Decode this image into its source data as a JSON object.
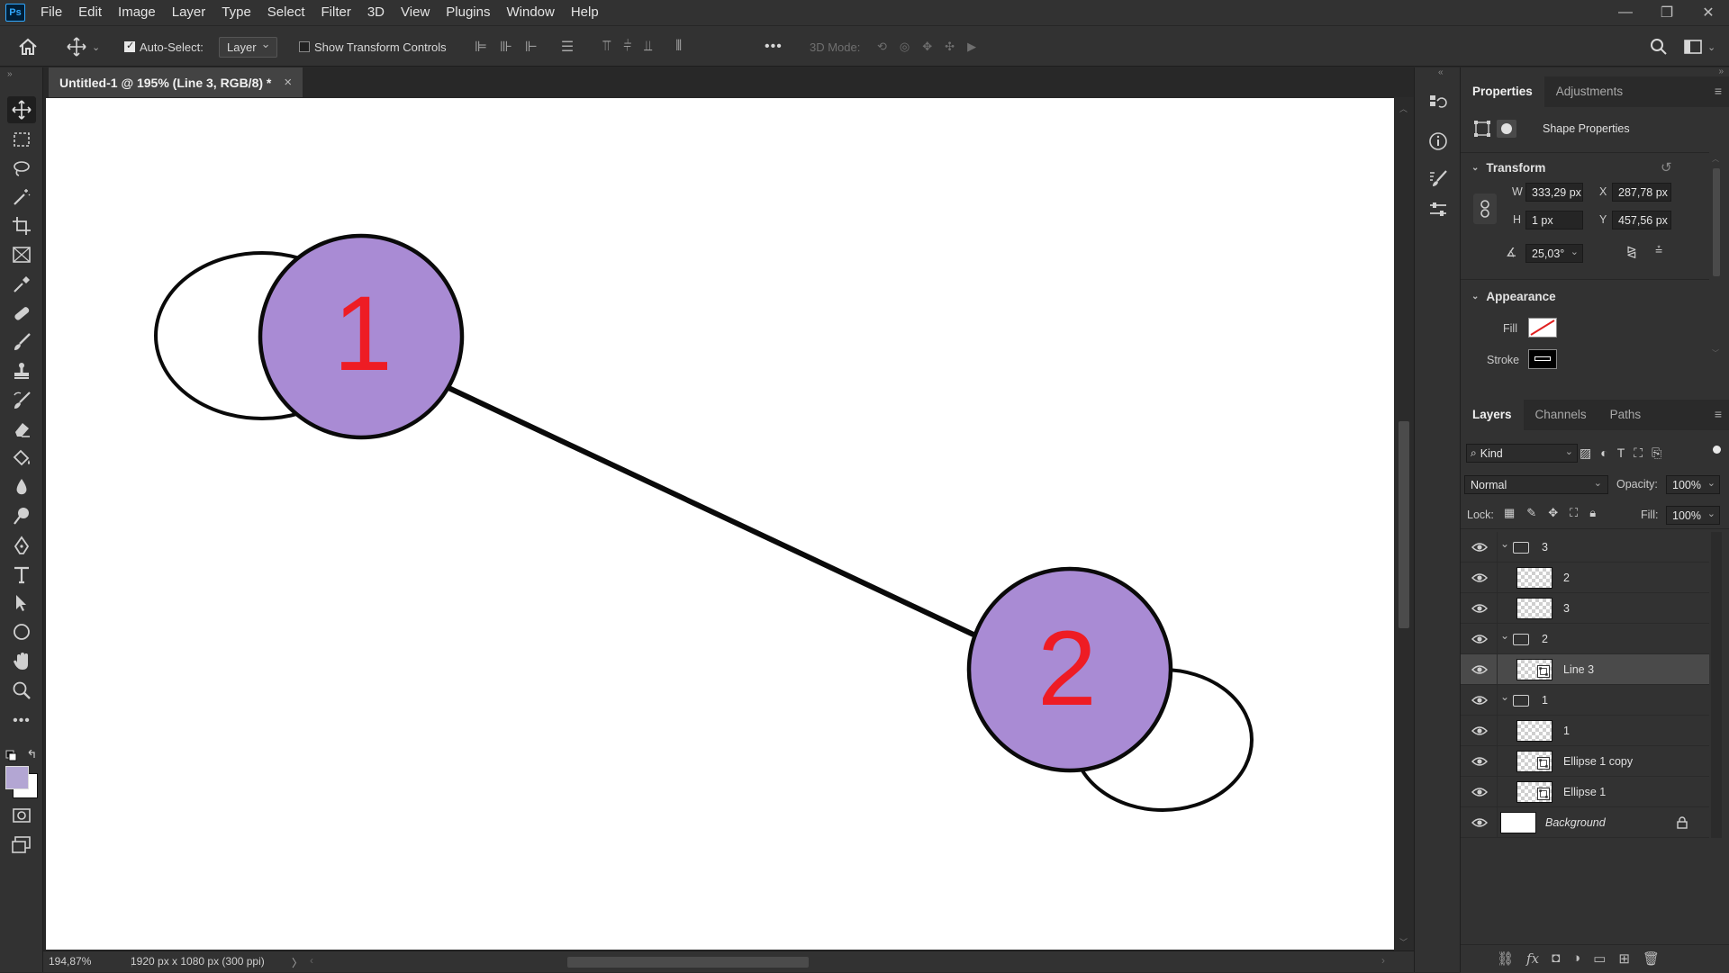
{
  "app": {
    "logo": "Ps"
  },
  "menu": [
    "File",
    "Edit",
    "Image",
    "Layer",
    "Type",
    "Select",
    "Filter",
    "3D",
    "View",
    "Plugins",
    "Window",
    "Help"
  ],
  "window_controls": {
    "minimize": "—",
    "restore": "❐",
    "close": "✕"
  },
  "options_bar": {
    "auto_select_label": "Auto-Select:",
    "auto_select_checked": true,
    "auto_select_target": "Layer",
    "show_transform_label": "Show Transform Controls",
    "show_transform_checked": false,
    "more": "•••",
    "mode_3d_label": "3D Mode:"
  },
  "document": {
    "tab_title": "Untitled-1 @ 195% (Line 3, RGB/8) *",
    "close": "×"
  },
  "canvas": {
    "node1_label": "1",
    "node2_label": "2",
    "node_fill": "#a98bd4",
    "label_color": "#ee1c24"
  },
  "status": {
    "zoom": "194,87%",
    "doc_info": "1920 px x 1080 px (300 ppi)",
    "arrow": "〉"
  },
  "properties_panel": {
    "tabs": [
      "Properties",
      "Adjustments"
    ],
    "active_tab": "Properties",
    "subtitle": "Shape Properties",
    "transform_title": "Transform",
    "w_label": "W",
    "w_value": "333,29 px",
    "x_label": "X",
    "x_value": "287,78 px",
    "h_label": "H",
    "h_value": "1 px",
    "y_label": "Y",
    "y_value": "457,56 px",
    "angle_value": "25,03°",
    "appearance_title": "Appearance",
    "fill_label": "Fill",
    "stroke_label": "Stroke"
  },
  "layers_panel": {
    "tabs": [
      "Layers",
      "Channels",
      "Paths"
    ],
    "active_tab": "Layers",
    "filter_label": "Kind",
    "blend_mode": "Normal",
    "opacity_label": "Opacity:",
    "opacity_value": "100%",
    "lock_label": "Lock:",
    "fill_label": "Fill:",
    "fill_value": "100%",
    "layers": [
      {
        "name": "3",
        "type": "group",
        "indent": 0,
        "selected": false
      },
      {
        "name": "2",
        "type": "pixel",
        "indent": 1,
        "selected": false
      },
      {
        "name": "3",
        "type": "pixel",
        "indent": 1,
        "selected": false
      },
      {
        "name": "2",
        "type": "group",
        "indent": 0,
        "selected": false
      },
      {
        "name": "Line 3",
        "type": "shape",
        "indent": 1,
        "selected": true
      },
      {
        "name": "1",
        "type": "group",
        "indent": 0,
        "selected": false
      },
      {
        "name": "1",
        "type": "pixel",
        "indent": 1,
        "selected": false
      },
      {
        "name": "Ellipse 1 copy",
        "type": "shape",
        "indent": 1,
        "selected": false
      },
      {
        "name": "Ellipse 1",
        "type": "shape",
        "indent": 1,
        "selected": false
      },
      {
        "name": "Background",
        "type": "background",
        "indent": 0,
        "selected": false
      }
    ]
  }
}
